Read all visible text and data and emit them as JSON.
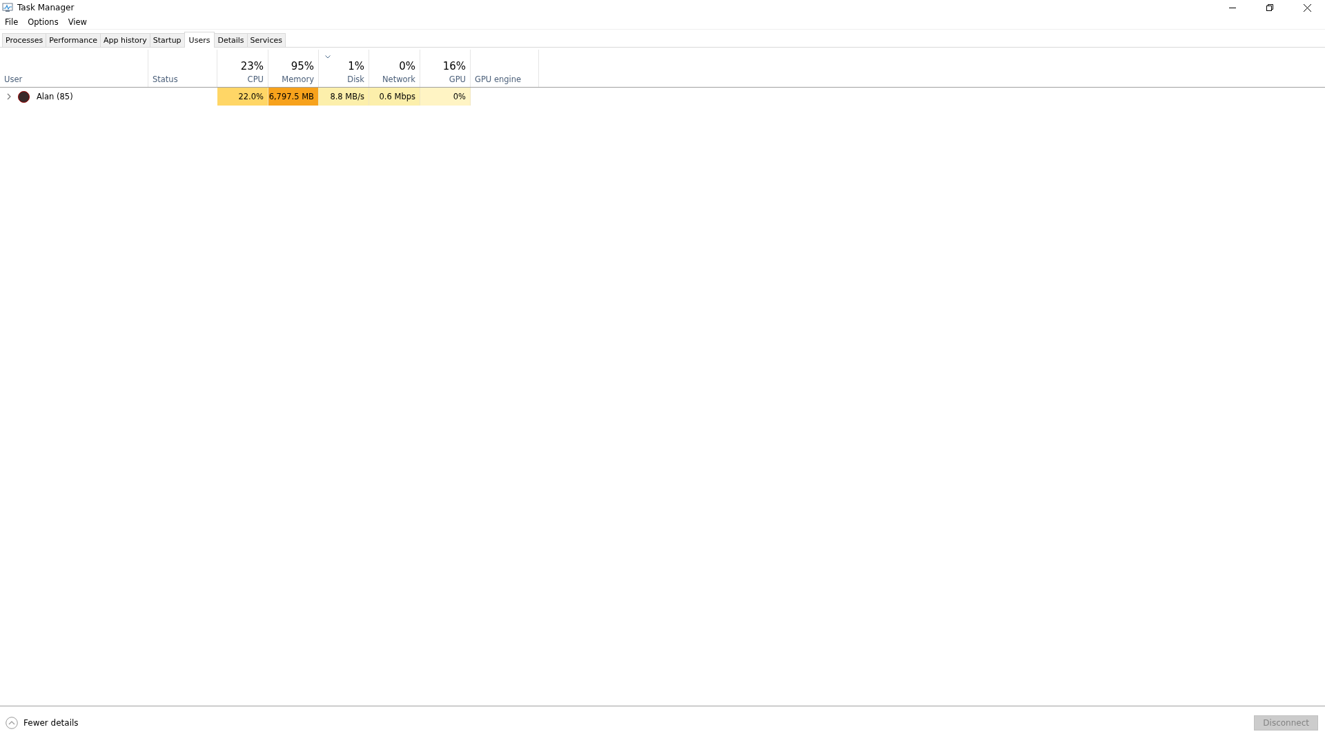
{
  "window": {
    "title": "Task Manager"
  },
  "menu": [
    "File",
    "Options",
    "View"
  ],
  "tabs": [
    {
      "label": "Processes",
      "selected": false
    },
    {
      "label": "Performance",
      "selected": false
    },
    {
      "label": "App history",
      "selected": false
    },
    {
      "label": "Startup",
      "selected": false
    },
    {
      "label": "Users",
      "selected": true
    },
    {
      "label": "Details",
      "selected": false
    },
    {
      "label": "Services",
      "selected": false
    }
  ],
  "table": {
    "columns": [
      {
        "label": "User",
        "sorted": false
      },
      {
        "label": "Status",
        "sorted": false
      },
      {
        "label": "CPU",
        "total": "23%",
        "sorted": false
      },
      {
        "label": "Memory",
        "total": "95%",
        "sorted": false
      },
      {
        "label": "Disk",
        "total": "1%",
        "sorted": true
      },
      {
        "label": "Network",
        "total": "0%",
        "sorted": false
      },
      {
        "label": "GPU",
        "total": "16%",
        "sorted": false
      },
      {
        "label": "GPU engine",
        "sorted": false
      }
    ],
    "rows": [
      {
        "expanded": false,
        "cells": [
          {
            "value": "Alan (85)"
          },
          {},
          {
            "value": "22.0%",
            "color": "#ffd666"
          },
          {
            "value": "6,797.5 MB",
            "color": "#f7a21c"
          },
          {
            "value": "8.8 MB/s",
            "color": "#fcefab"
          },
          {
            "value": "0.6 Mbps",
            "color": "#fcefab"
          },
          {
            "value": "0%",
            "color": "#fff4c4"
          },
          {}
        ]
      }
    ]
  },
  "footer": {
    "toggle": "Fewer details",
    "button": {
      "label": "Disconnect",
      "disabled": true
    }
  }
}
